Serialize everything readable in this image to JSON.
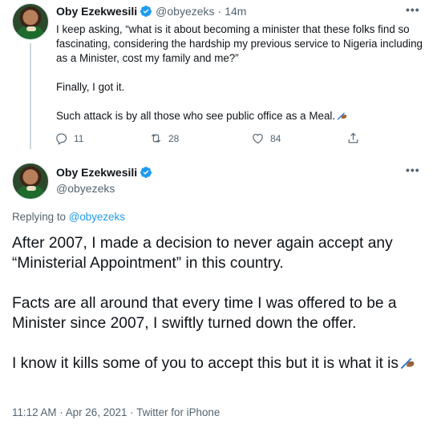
{
  "tweet1": {
    "display_name": "Oby Ezekwesili",
    "handle": "@obyezeks",
    "separator": "·",
    "time": "14m",
    "paragraphs": [
      "I keep asking, “what is it about becoming a minister that these folks find so fascinating, considering the hardship my previous service to Nigeria including as a Minister, cost my family and me?”",
      "Finally, I got it.",
      "Such attack is by all those who see public office as a Meal."
    ],
    "replies": "11",
    "retweets": "28",
    "likes": "84"
  },
  "tweet2": {
    "display_name": "Oby Ezekwesili",
    "handle": "@obyezeks",
    "replying_label": "Replying to",
    "replying_to": "@obyezeks",
    "paragraphs": [
      "After 2007, I made a decision to never again accept any “Ministerial  Appointment” in this country.",
      "Facts are all around that every time I was offered to be a Minister since 2007, I swiftly turned down the offer.",
      "I know it kills some of you to accept this but it is what it is"
    ],
    "timestamp": "11:12 AM · Apr 26, 2021",
    "source_sep": "·",
    "source": "Twitter for iPhone"
  },
  "icons": {
    "verified": "verified-badge-icon",
    "more": "more-horizontal-icon",
    "reply": "reply-icon",
    "retweet": "retweet-icon",
    "like": "heart-icon",
    "share": "share-icon",
    "emoji": "writing-hand-emoji"
  },
  "colors": {
    "accent": "#1d9bf0",
    "text": "#0f1419",
    "secondary": "#536471"
  }
}
